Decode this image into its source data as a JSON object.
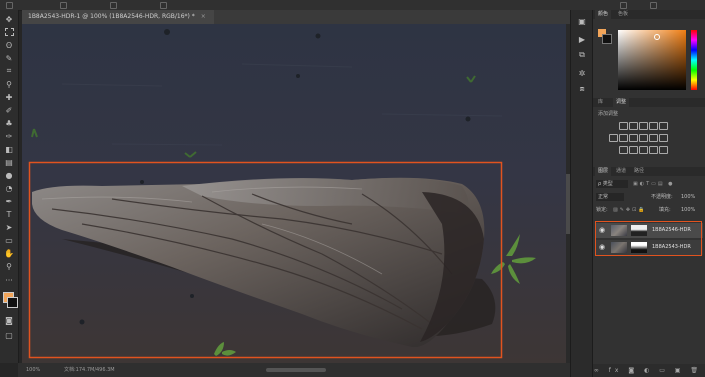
{
  "document": {
    "tab_title": "1B8A2543-HDR-1 @ 100% (1B8A2546-HDR, RGB/16*) *",
    "zoom": "100%",
    "doc_info": "文档:174.7M/496.3M"
  },
  "colors": {
    "foreground": "#f2a55a",
    "background": "#111111",
    "highlight_box": "#e1531f",
    "accent": "#e1531f"
  },
  "tools": [
    "move-tool",
    "marquee-tool",
    "lasso-tool",
    "quick-select-tool",
    "crop-tool",
    "eyedropper-tool",
    "healing-tool",
    "brush-tool",
    "clone-stamp-tool",
    "history-brush-tool",
    "eraser-tool",
    "gradient-tool",
    "blur-tool",
    "dodge-tool",
    "pen-tool",
    "type-tool",
    "path-select-tool",
    "shape-tool",
    "hand-tool",
    "zoom-tool",
    "more-tools"
  ],
  "color_panel": {
    "tabs": [
      "颜色",
      "色板"
    ]
  },
  "adjust_panel": {
    "tabs": [
      "库",
      "调整"
    ],
    "title": "添加调整"
  },
  "layers_panel": {
    "tabs": [
      "图层",
      "通道",
      "路径"
    ],
    "filter_kind": "ρ 类型",
    "blend_mode": "正常",
    "opacity_label": "不透明度:",
    "opacity_value": "100%",
    "lock_label": "锁定:",
    "fill_label": "填充:",
    "fill_value": "100%",
    "layers": [
      {
        "name": "1B8A2546-HDR",
        "selected": true
      },
      {
        "name": "1B8A2543-HDR",
        "selected": false
      }
    ]
  }
}
